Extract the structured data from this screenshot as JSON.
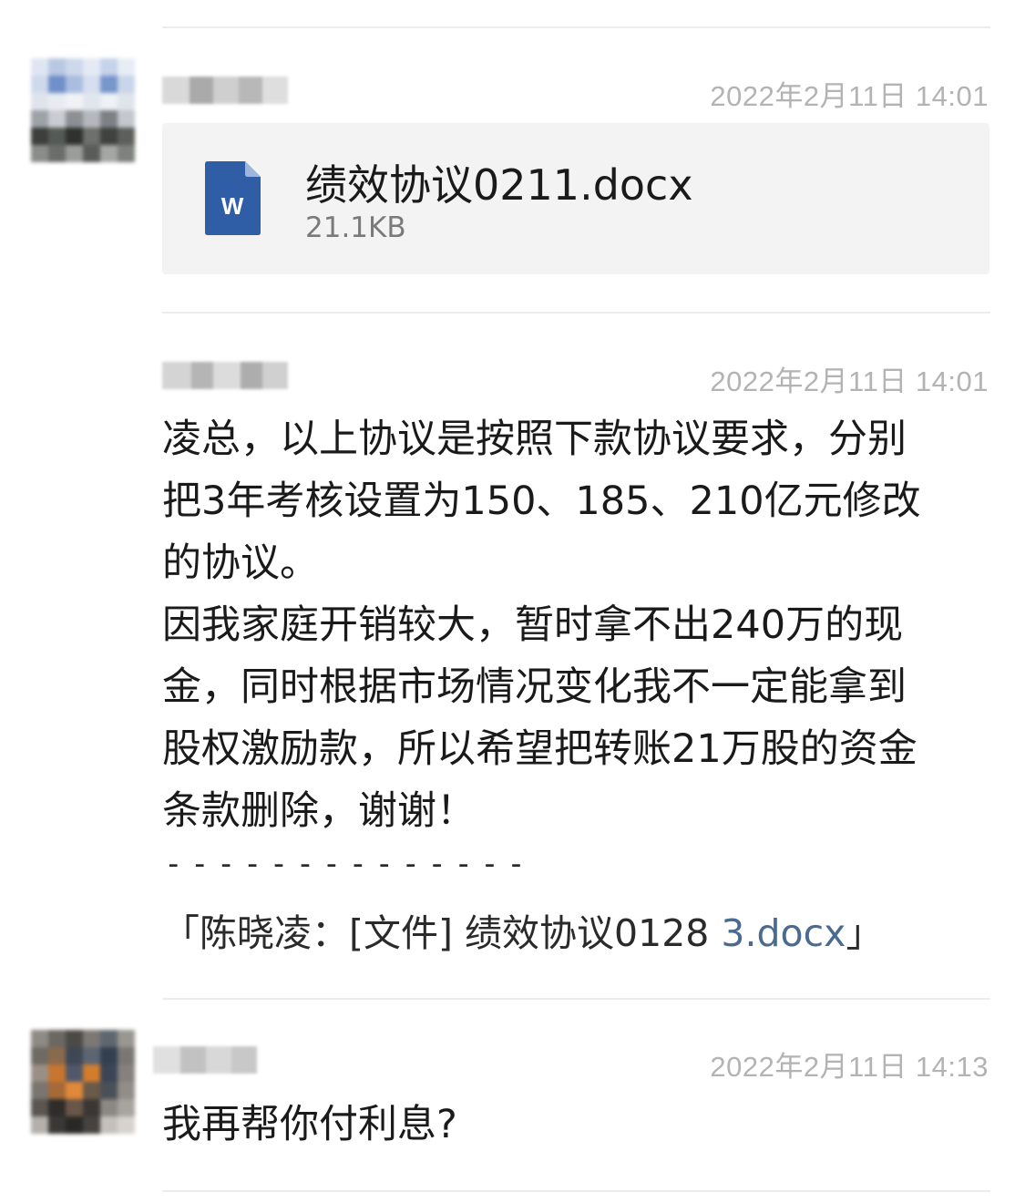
{
  "messages": [
    {
      "timestamp": "2022年2月11日 14:01",
      "file": {
        "name": "绩效协议0211.docx",
        "size": "21.1KB",
        "icon": "word-document-icon",
        "icon_letter": "W",
        "icon_color": "#2f5ea7"
      }
    },
    {
      "timestamp": "2022年2月11日 14:01",
      "text_lines": [
        "凌总，以上协议是按照下款协议要求，分别",
        "把3年考核设置为150、185、210亿元修改",
        "的协议。",
        "因我家庭开销较大，暂时拿不出240万的现",
        "金，同时根据市场情况变化我不一定能拿到",
        "股权激励款，所以希望把转账21万股的资金",
        "条款删除，谢谢！"
      ],
      "separator": "- - - - - - - - - - - - - -",
      "quote": {
        "prefix": "「陈晓凌：[文件] 绩效协议0128 ",
        "link": "3.docx",
        "suffix": "」"
      }
    },
    {
      "timestamp": "2022年2月11日 14:13",
      "text_lines": [
        "我再帮你付利息?"
      ]
    }
  ],
  "colors": {
    "timestamp": "#b3b3b3",
    "file_card_bg": "#f3f3f3",
    "link": "#4a6b8f",
    "divider": "#ececec"
  }
}
